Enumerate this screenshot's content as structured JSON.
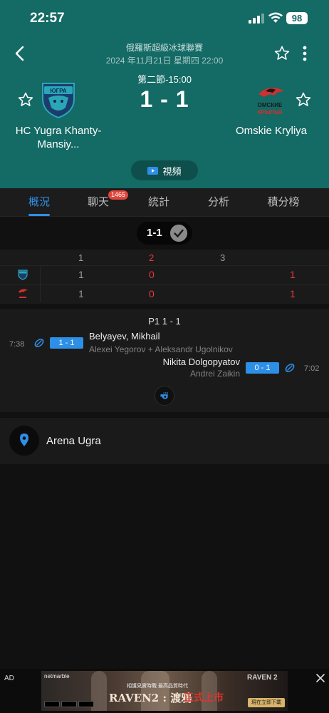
{
  "status_bar": {
    "time": "22:57",
    "battery": "98"
  },
  "header": {
    "league": "俄羅斯超級冰球聯賽",
    "datetime": "2024 年11月21日 星期四 22:00",
    "period_time": "第二節-15:00",
    "score": "1 - 1",
    "video_label": "視頻"
  },
  "home_team": {
    "name": "HC Yugra Khanty-Mansiy...",
    "color": "#2aa6b8"
  },
  "away_team": {
    "name": "Omskie Kryliya",
    "color": "#d32f2f"
  },
  "tabs": [
    {
      "label": "概況",
      "active": true
    },
    {
      "label": "聊天",
      "badge": "1465"
    },
    {
      "label": "統計"
    },
    {
      "label": "分析"
    },
    {
      "label": "積分榜"
    }
  ],
  "scoreline": {
    "text": "1-1"
  },
  "period_table": {
    "headers": [
      "1",
      "2",
      "3"
    ],
    "current_period_index": 1,
    "rows": [
      {
        "team": "home",
        "periods": [
          "1",
          "0"
        ],
        "total": "1"
      },
      {
        "team": "away",
        "periods": [
          "1",
          "0"
        ],
        "total": "1"
      }
    ]
  },
  "events": {
    "title": "P1 1 - 1",
    "items": [
      {
        "side": "home",
        "time": "7:38",
        "score": "1 - 1",
        "scorer": "Belyayev, Mikhail",
        "assists": "Alexei Yegorov + Aleksandr Ugolnikov"
      },
      {
        "side": "away",
        "time": "7:02",
        "score": "0 - 1",
        "scorer": "Nikita Dolgopyatov",
        "assists": "Andrei Zaikin"
      }
    ]
  },
  "venue": {
    "name": "Arena Ugra"
  },
  "ad": {
    "label": "AD",
    "brand": "netmarble",
    "subtitle": "相護見實時戰 最高品質時代",
    "title": "RAVEN2 : 渡鴉",
    "title_accent": "正式上市",
    "logo_text": "RAVEN 2",
    "cta": "現在立即下載"
  },
  "colors": {
    "accent": "#2e8fe6",
    "header_bg": "#146a65",
    "live_red": "#e5393a"
  }
}
